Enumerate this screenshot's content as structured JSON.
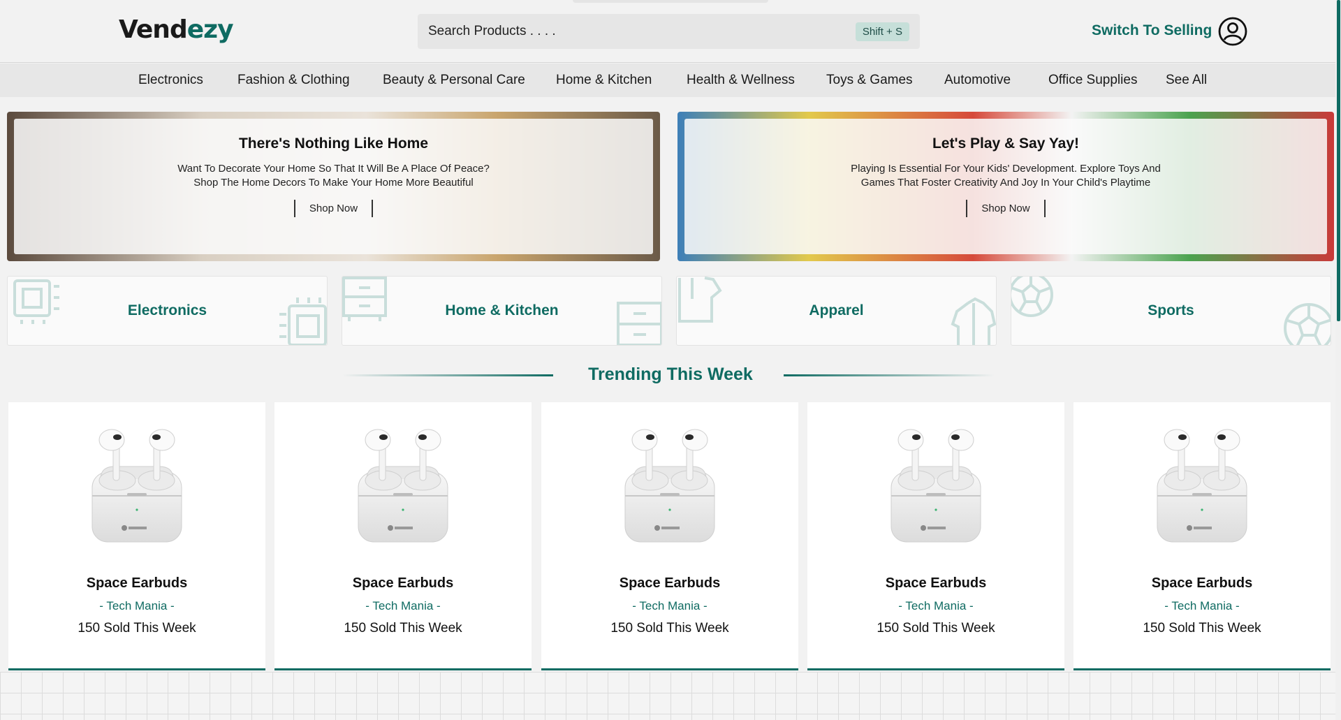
{
  "header": {
    "logo_part1": "Vend",
    "logo_part2": "ezy",
    "search_placeholder": "Search Products . . . .",
    "search_shortcut": "Shift + S",
    "switch_label": "Switch To Selling",
    "avatar_icon": "user-circle-icon"
  },
  "nav": {
    "items": [
      {
        "label": "Electronics"
      },
      {
        "label": "Fashion & Clothing"
      },
      {
        "label": "Beauty & Personal Care"
      },
      {
        "label": "Home & Kitchen"
      },
      {
        "label": "Health & Wellness"
      },
      {
        "label": "Toys & Games"
      },
      {
        "label": "Automotive"
      },
      {
        "label": "Office Supplies"
      },
      {
        "label": "See All"
      }
    ]
  },
  "banners": [
    {
      "title": "There's Nothing Like Home",
      "description": "Want To Decorate Your Home So That It Will Be A Place Of Peace? Shop The Home Decors To Make Your Home More Beautiful",
      "button": "Shop Now"
    },
    {
      "title": "Let's Play & Say Yay!",
      "description": "Playing Is Essential For Your Kids' Development. Explore Toys And Games That Foster Creativity And Joy In Your Child's Playtime",
      "button": "Shop Now"
    }
  ],
  "categories": [
    {
      "label": "Electronics",
      "icon": "chip-icon"
    },
    {
      "label": "Home & Kitchen",
      "icon": "cabinet-icon"
    },
    {
      "label": "Apparel",
      "icon": "shirt-icon"
    },
    {
      "label": "Sports",
      "icon": "ball-icon"
    }
  ],
  "trending": {
    "title": "Trending This Week",
    "products": [
      {
        "name": "Space Earbuds",
        "brand": "- Tech Mania -",
        "sold": "150 Sold This Week"
      },
      {
        "name": "Space Earbuds",
        "brand": "- Tech Mania -",
        "sold": "150 Sold This Week"
      },
      {
        "name": "Space Earbuds",
        "brand": "- Tech Mania -",
        "sold": "150 Sold This Week"
      },
      {
        "name": "Space Earbuds",
        "brand": "- Tech Mania -",
        "sold": "150 Sold This Week"
      },
      {
        "name": "Space Earbuds",
        "brand": "- Tech Mania -",
        "sold": "150 Sold This Week"
      }
    ]
  },
  "colors": {
    "accent": "#0f6b62",
    "background": "#f2f2f2"
  }
}
